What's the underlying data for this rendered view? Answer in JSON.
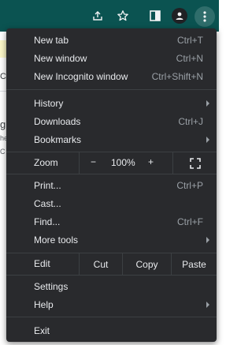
{
  "toolbar": {
    "icons": [
      "share-icon",
      "bookmark-star-icon",
      "side-panel-icon",
      "profile-icon",
      "more-options-icon"
    ]
  },
  "background_page": {
    "fragments": [
      "C",
      "g",
      "he",
      "C"
    ]
  },
  "menu": {
    "new_tab": {
      "label": "New tab",
      "shortcut": "Ctrl+T"
    },
    "new_window": {
      "label": "New window",
      "shortcut": "Ctrl+N"
    },
    "new_incognito": {
      "label": "New Incognito window",
      "shortcut": "Ctrl+Shift+N"
    },
    "history": {
      "label": "History"
    },
    "downloads": {
      "label": "Downloads",
      "shortcut": "Ctrl+J"
    },
    "bookmarks": {
      "label": "Bookmarks"
    },
    "zoom": {
      "label": "Zoom",
      "minus": "−",
      "level": "100%",
      "plus": "+"
    },
    "print": {
      "label": "Print...",
      "shortcut": "Ctrl+P"
    },
    "cast": {
      "label": "Cast..."
    },
    "find": {
      "label": "Find...",
      "shortcut": "Ctrl+F"
    },
    "more_tools": {
      "label": "More tools"
    },
    "edit": {
      "label": "Edit",
      "cut": "Cut",
      "copy": "Copy",
      "paste": "Paste"
    },
    "settings": {
      "label": "Settings"
    },
    "help": {
      "label": "Help"
    },
    "exit": {
      "label": "Exit"
    }
  },
  "colors": {
    "toolbar": "#0b5351",
    "menu_bg": "#292a2d",
    "separator": "#3c4043",
    "text": "#e8eaed",
    "shortcut_text": "#9aa0a6"
  }
}
